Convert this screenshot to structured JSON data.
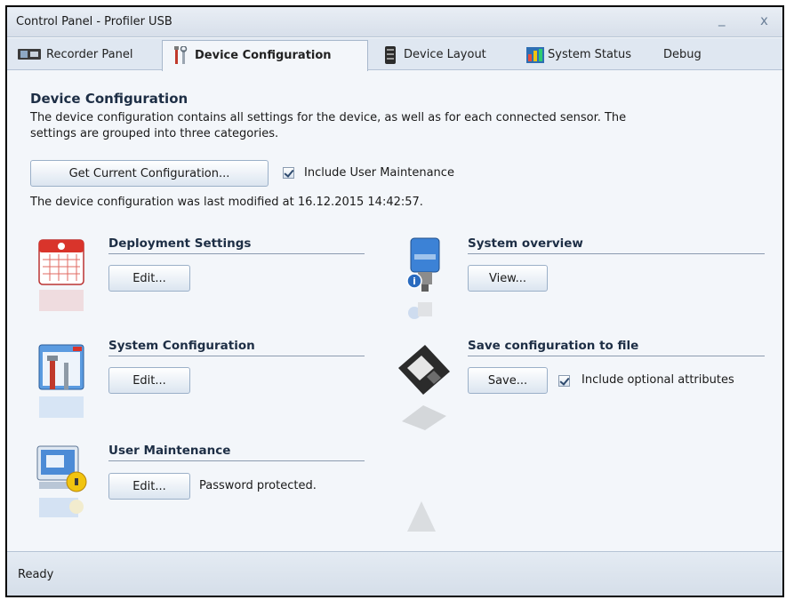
{
  "window": {
    "title": "Control Panel - Profiler USB",
    "minimize_glyph": "_",
    "close_glyph": "x"
  },
  "tabs": [
    {
      "label": "Recorder Panel",
      "icon": "recorder-panel-icon"
    },
    {
      "label": "Device Configuration",
      "icon": "tools-icon",
      "active": true
    },
    {
      "label": "Device Layout",
      "icon": "device-layout-icon"
    },
    {
      "label": "System Status",
      "icon": "system-status-icon"
    },
    {
      "label": "Debug"
    }
  ],
  "main": {
    "heading": "Device Configuration",
    "description": "The device configuration contains all settings for the device, as well as for each connected sensor. The settings are grouped into three categories.",
    "get_config_button": "Get Current Configuration...",
    "include_user_maintenance_label": "Include User Maintenance",
    "include_user_maintenance_checked": true,
    "last_modified": "The device configuration was last modified at 16.12.2015 14:42:57."
  },
  "sections": {
    "deployment": {
      "title": "Deployment Settings",
      "button": "Edit...",
      "icon": "calendar-icon"
    },
    "system_configuration": {
      "title": "System Configuration",
      "button": "Edit...",
      "icon": "tools-window-icon"
    },
    "user_maintenance": {
      "title": "User Maintenance",
      "button": "Edit...",
      "note": "Password protected.",
      "icon": "computer-lock-icon"
    },
    "system_overview": {
      "title": "System overview",
      "button": "View...",
      "icon": "sensor-info-icon"
    },
    "save_config": {
      "title": "Save configuration to file",
      "button": "Save...",
      "checkbox_label": "Include optional attributes",
      "checkbox_checked": true,
      "icon": "floppy-disk-icon"
    }
  },
  "status": {
    "text": "Ready"
  },
  "colors": {
    "accent": "#1d2e45",
    "background": "#f3f6fa",
    "tabbar": "#dfe7f1"
  }
}
